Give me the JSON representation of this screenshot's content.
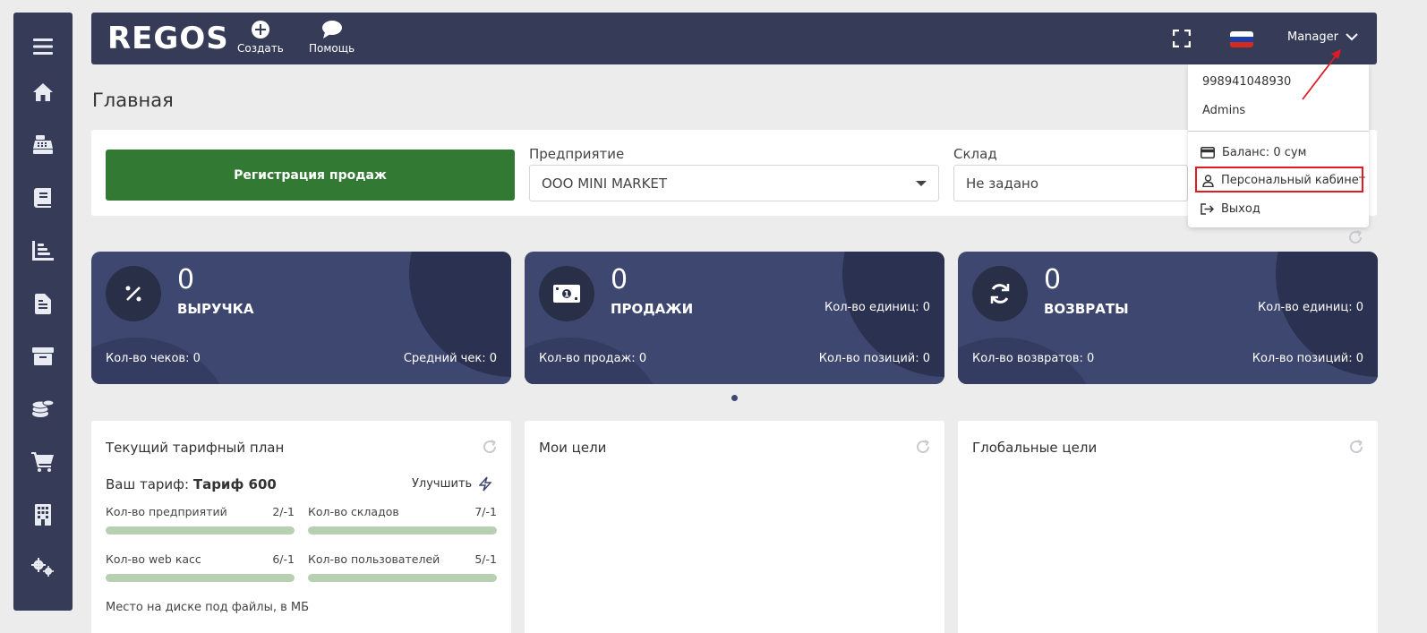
{
  "app": {
    "logo": "REGOS"
  },
  "header": {
    "create_label": "Создать",
    "help_label": "Помощь",
    "user_label": "Manager"
  },
  "user_dropdown": {
    "phone": "998941048930",
    "role": "Admins",
    "balance_label": "Баланс: 0 сум",
    "personal_cabinet_label": "Персональный кабинет",
    "logout_label": "Выход"
  },
  "page": {
    "title": "Главная"
  },
  "filters": {
    "register_sales_label": "Регистрация продаж",
    "enterprise_label": "Предприятие",
    "enterprise_value": "ООО MINI MARKET",
    "warehouse_label": "Склад",
    "warehouse_value": "Не задано"
  },
  "stats": [
    {
      "value": "0",
      "name": "ВЫРУЧКА",
      "right_top": "",
      "bottom_left": "Кол-во чеков: 0",
      "bottom_right": "Средний чек: 0"
    },
    {
      "value": "0",
      "name": "ПРОДАЖИ",
      "right_top": "Кол-во единиц: 0",
      "bottom_left": "Кол-во продаж: 0",
      "bottom_right": "Кол-во позиций: 0"
    },
    {
      "value": "0",
      "name": "ВОЗВРАТЫ",
      "right_top": "Кол-во единиц: 0",
      "bottom_left": "Кол-во возвратов: 0",
      "bottom_right": "Кол-во позиций: 0"
    }
  ],
  "tariff": {
    "title": "Текущий тарифный план",
    "your_tariff_label": "Ваш тариф:",
    "tariff_name": "Тариф 600",
    "upgrade_label": "Улучшить",
    "limits": [
      {
        "label": "Кол-во предприятий",
        "value": "2/-1",
        "fill": 1.0
      },
      {
        "label": "Кол-во складов",
        "value": "7/-1",
        "fill": 1.0
      },
      {
        "label": "Кол-во web касс",
        "value": "6/-1",
        "fill": 1.0
      },
      {
        "label": "Кол-во пользователей",
        "value": "5/-1",
        "fill": 1.0
      }
    ],
    "disk_label": "Место на диске под файлы, в МБ"
  },
  "goals": {
    "my_goals_title": "Мои цели",
    "global_goals_title": "Глобальные цели"
  },
  "colors": {
    "sidebar_bg": "#363c57",
    "card_bg": "#3d4770",
    "register_button": "#327934",
    "highlight_border": "#e01b24",
    "progress": "#b7d0b2"
  },
  "icons": {
    "sidebar": [
      "menu-icon",
      "home-icon",
      "cash-register-icon",
      "book-icon",
      "chart-icon",
      "document-icon",
      "box-icon",
      "coins-icon",
      "cart-icon",
      "building-icon",
      "settings-icon"
    ]
  }
}
